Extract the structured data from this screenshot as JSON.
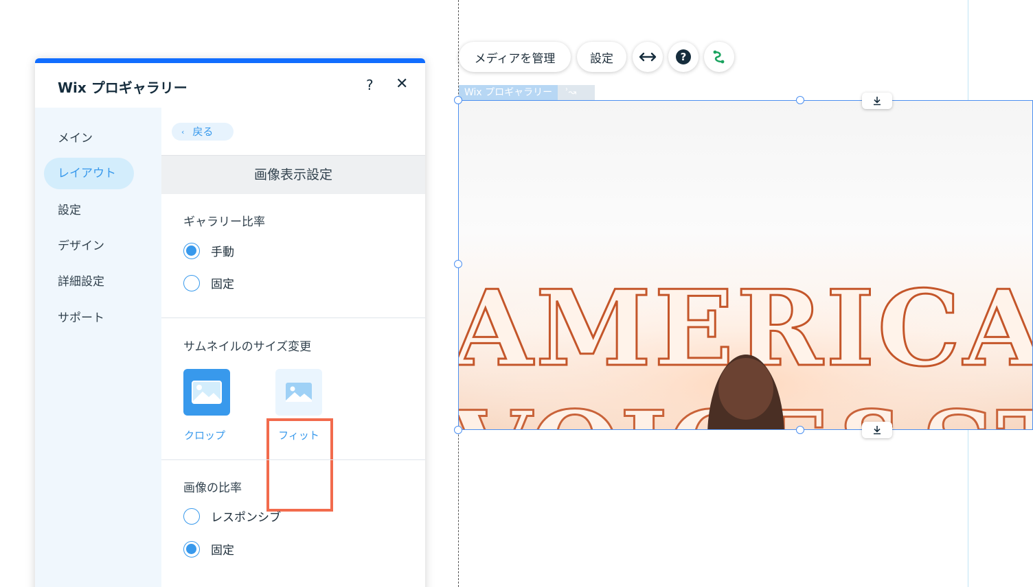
{
  "panel": {
    "title": "Wix プロギャラリー",
    "help_label": "?",
    "close_label": "✕"
  },
  "nav": {
    "items": [
      {
        "label": "メイン"
      },
      {
        "label": "レイアウト",
        "active": true
      },
      {
        "label": "設定"
      },
      {
        "label": "デザイン"
      },
      {
        "label": "詳細設定"
      },
      {
        "label": "サポート"
      }
    ]
  },
  "content": {
    "back_label": "戻る",
    "section_title": "画像表示設定",
    "gallery_ratio": {
      "label": "ギャラリー比率",
      "options": [
        {
          "label": "手動",
          "selected": true
        },
        {
          "label": "固定",
          "selected": false
        }
      ]
    },
    "thumbnail_resize": {
      "label": "サムネイルのサイズ変更",
      "options": [
        {
          "label": "クロップ",
          "selected": true
        },
        {
          "label": "フィット",
          "selected": false,
          "highlighted": true
        }
      ]
    },
    "image_ratio": {
      "label": "画像の比率",
      "options": [
        {
          "label": "レスポンシブ",
          "selected": false
        },
        {
          "label": "固定",
          "selected": true
        }
      ]
    }
  },
  "canvas": {
    "toolbar": {
      "manage_media": "メディアを管理",
      "settings": "設定"
    },
    "gallery_tag": "Wix プロギャラリー",
    "image_text": "AMERICA"
  },
  "colors": {
    "accent": "#3899ec",
    "topbar": "#116dff",
    "highlight": "#f26b4d",
    "selection": "#4b8ff0"
  }
}
